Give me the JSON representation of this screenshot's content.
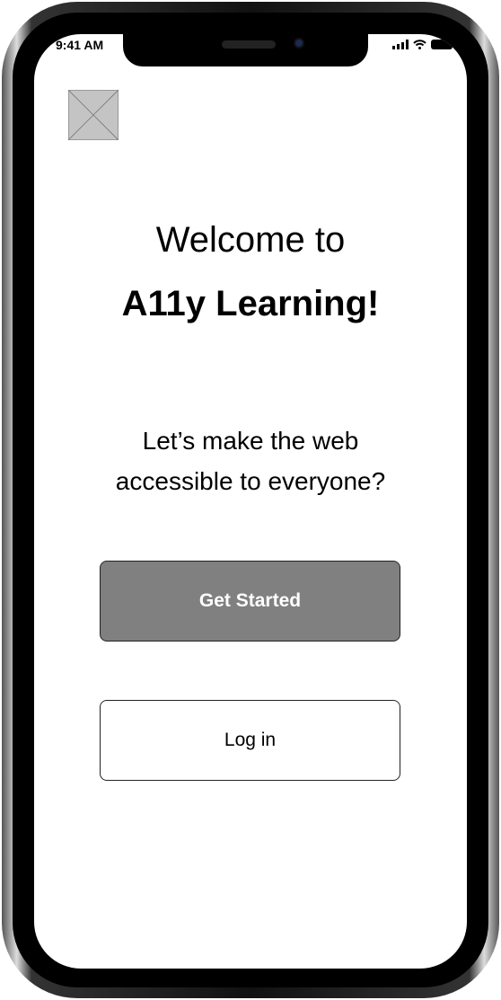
{
  "status_bar": {
    "time": "9:41 AM"
  },
  "welcome": {
    "line1": "Welcome to",
    "line2": "A11y Learning!"
  },
  "tagline": {
    "line1": "Let’s make the web",
    "line2": "accessible to everyone?"
  },
  "buttons": {
    "get_started": "Get Started",
    "log_in": "Log in"
  },
  "colors": {
    "primary_button": "#808080",
    "placeholder": "#c4c4c4"
  }
}
